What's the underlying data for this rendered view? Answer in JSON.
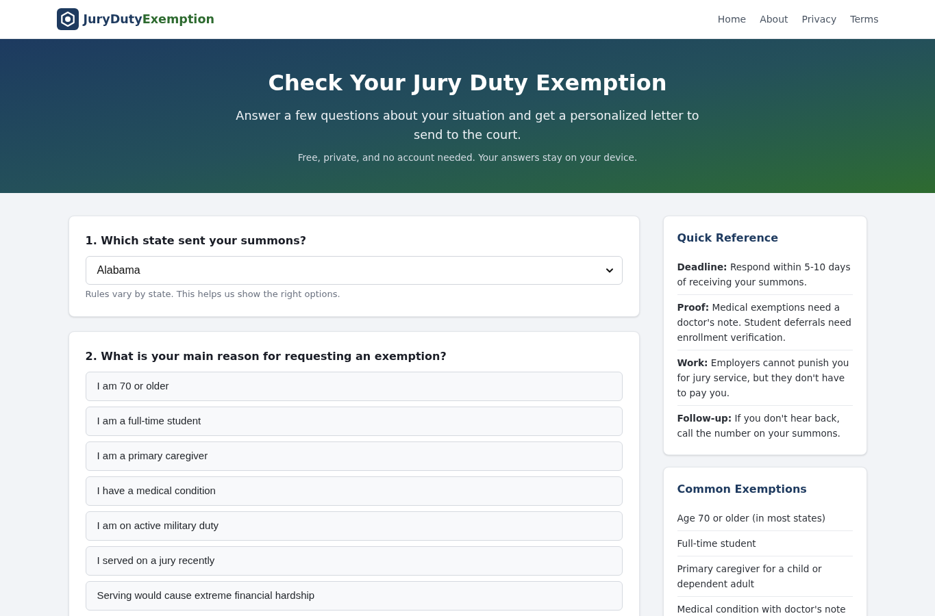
{
  "header": {
    "logo": {
      "name_primary": "JuryDuty",
      "name_accent": "Exemption"
    },
    "nav": [
      "Home",
      "About",
      "Privacy",
      "Terms"
    ]
  },
  "hero": {
    "title": "Check Your Jury Duty Exemption",
    "subtitle": "Answer a few questions about your situation and get a personalized letter to send to the court.",
    "note": "Free, private, and no account needed. Your answers stay on your device."
  },
  "questions": [
    {
      "kind": "select",
      "title": "1. Which state sent your summons?",
      "value": "Alabama",
      "hint": "Rules vary by state. This helps us show the right options."
    },
    {
      "kind": "choice",
      "title": "2. What is your main reason for requesting an exemption?",
      "options": [
        {
          "label": "I am 70 or older",
          "selected": false
        },
        {
          "label": "I am a full-time student",
          "selected": false
        },
        {
          "label": "I am a primary caregiver",
          "selected": false
        },
        {
          "label": "I have a medical condition",
          "selected": false
        },
        {
          "label": "I am on active military duty",
          "selected": false
        },
        {
          "label": "I served on a jury recently",
          "selected": false
        },
        {
          "label": "Serving would cause extreme financial hardship",
          "selected": false
        }
      ]
    }
  ],
  "sidebar": [
    {
      "title": "Quick Reference",
      "items": [
        "**Deadline:** Respond within 5-10 days of receiving your summons.",
        "**Proof:** Medical exemptions need a doctor's note. Student deferrals need enrollment verification.",
        "**Work:** Employers cannot punish you for jury service, but they don't have to pay you.",
        "**Follow-up:** If you don't hear back, call the number on your summons."
      ]
    },
    {
      "title": "Common Exemptions",
      "items": [
        "Age 70 or older (in most states)",
        "Full-time student",
        "Primary caregiver for a child or dependent adult",
        "Medical condition with doctor's note"
      ]
    }
  ]
}
